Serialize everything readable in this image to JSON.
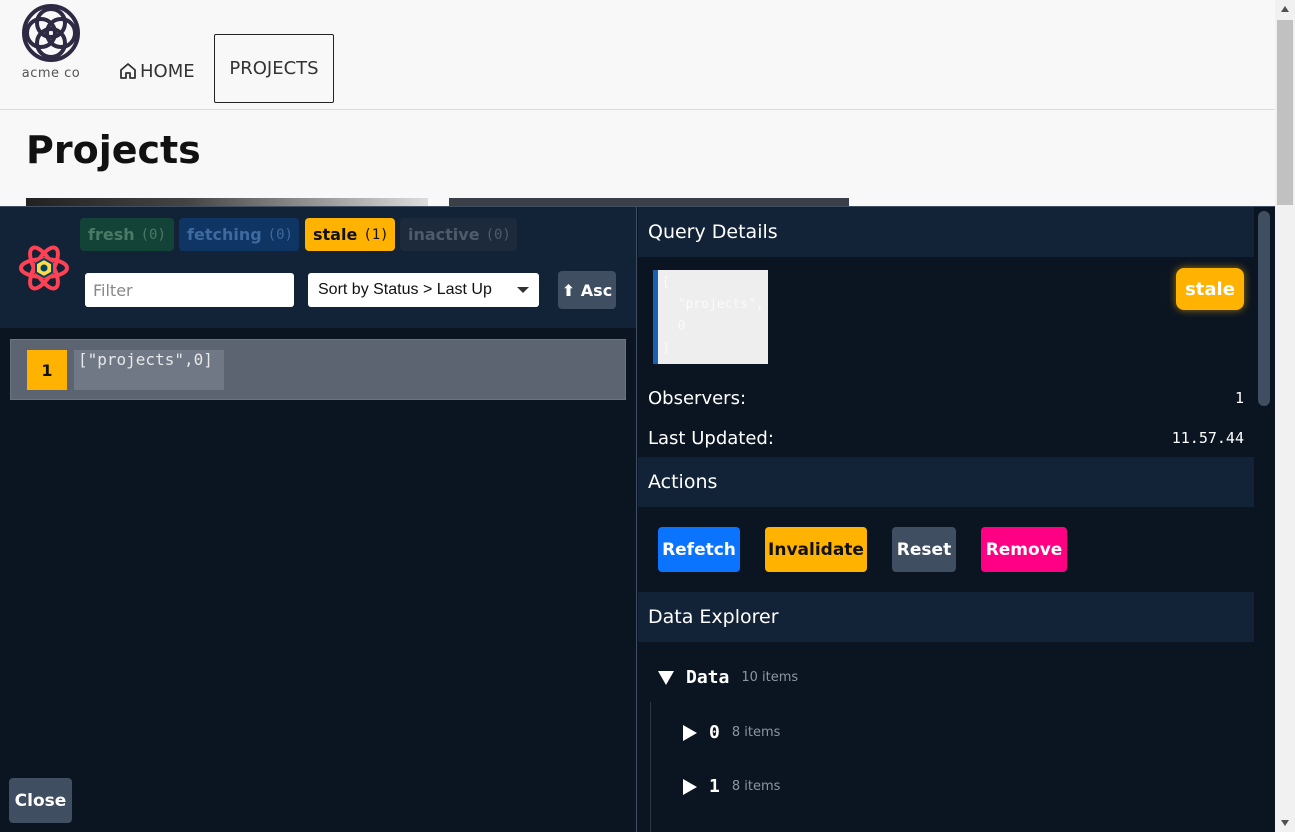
{
  "site": {
    "logo_text": "acme co",
    "nav": {
      "home_label": "HOME",
      "projects_label": "PROJECTS"
    },
    "page_title": "Projects"
  },
  "devtools": {
    "status_filters": [
      {
        "label": "fresh",
        "count": "(0)",
        "color": "#134236"
      },
      {
        "label": "fetching",
        "count": "(0)",
        "color": "#0e3564"
      },
      {
        "label": "stale",
        "count": "(1)",
        "color": "#ffb200"
      },
      {
        "label": "inactive",
        "count": "(0)",
        "color": "#1c2a3b"
      }
    ],
    "filter": {
      "placeholder": "Filter",
      "value": ""
    },
    "sort": {
      "selected": "Sort by Status > Last Up"
    },
    "order_button": {
      "label": "⬆ Asc"
    },
    "queries": [
      {
        "observers": "1",
        "key": "[\"projects\",0]",
        "status": "stale"
      }
    ],
    "close_label": "Close",
    "details": {
      "heading": "Query Details",
      "query_key_pretty": "[\n  \"projects\",\n  0\n]",
      "status_badge": "stale",
      "observers_label": "Observers:",
      "observers_value": "1",
      "last_updated_label": "Last Updated:",
      "last_updated_value": "11.57.44"
    },
    "actions": {
      "heading": "Actions",
      "refetch": "Refetch",
      "invalidate": "Invalidate",
      "reset": "Reset",
      "remove": "Remove"
    },
    "explorer": {
      "heading": "Data Explorer",
      "root": {
        "label": "Data",
        "count": "10 items"
      },
      "items": [
        {
          "label": "0",
          "count": "8 items"
        },
        {
          "label": "1",
          "count": "8 items"
        }
      ]
    },
    "colors": {
      "panel_bg": "#0b1521",
      "header_bg": "#132337",
      "stale": "#ffb200",
      "refetch": "#0b74ff",
      "remove": "#ff0085",
      "neutral": "#3f4e60"
    }
  }
}
